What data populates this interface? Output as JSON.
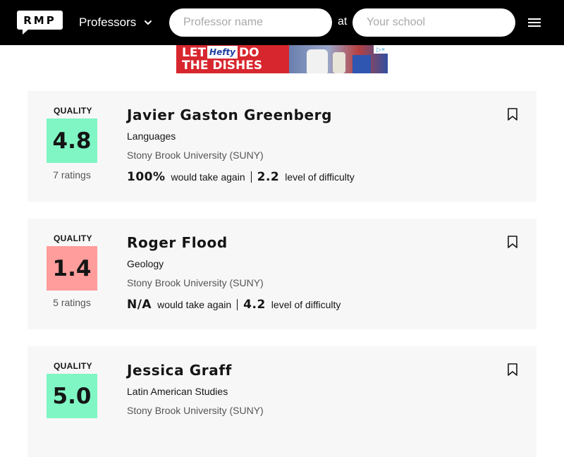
{
  "header": {
    "logo_text": "RMP",
    "search_type": "Professors",
    "professor_placeholder": "Professor name",
    "at_label": "at",
    "school_placeholder": "Your school"
  },
  "ad": {
    "line1_before": "LET",
    "brand": "Hefty",
    "line1_after": "DO",
    "line2": "THE DISHES"
  },
  "colors": {
    "header_bg": "#000000",
    "card_bg": "#f7f7f7",
    "quality_good": "#7ff6c3",
    "quality_poor": "#ff9c9c"
  },
  "results": [
    {
      "quality_label": "QUALITY",
      "quality": "4.8",
      "quality_color": "#7ff6c3",
      "ratings": "7 ratings",
      "name": "Javier Gaston Greenberg",
      "department": "Languages",
      "school": "Stony Brook University (SUNY)",
      "take_again": "100%",
      "take_again_label": "would take again",
      "difficulty": "2.2",
      "difficulty_label": "level of difficulty"
    },
    {
      "quality_label": "QUALITY",
      "quality": "1.4",
      "quality_color": "#ff9c9c",
      "ratings": "5 ratings",
      "name": "Roger Flood",
      "department": "Geology",
      "school": "Stony Brook University (SUNY)",
      "take_again": "N/A",
      "take_again_label": "would take again",
      "difficulty": "4.2",
      "difficulty_label": "level of difficulty"
    },
    {
      "quality_label": "QUALITY",
      "quality": "5.0",
      "quality_color": "#7ff6c3",
      "ratings": "",
      "name": "Jessica Graff",
      "department": "Latin American Studies",
      "school": "Stony Brook University (SUNY)",
      "take_again": "",
      "take_again_label": "",
      "difficulty": "",
      "difficulty_label": ""
    }
  ]
}
